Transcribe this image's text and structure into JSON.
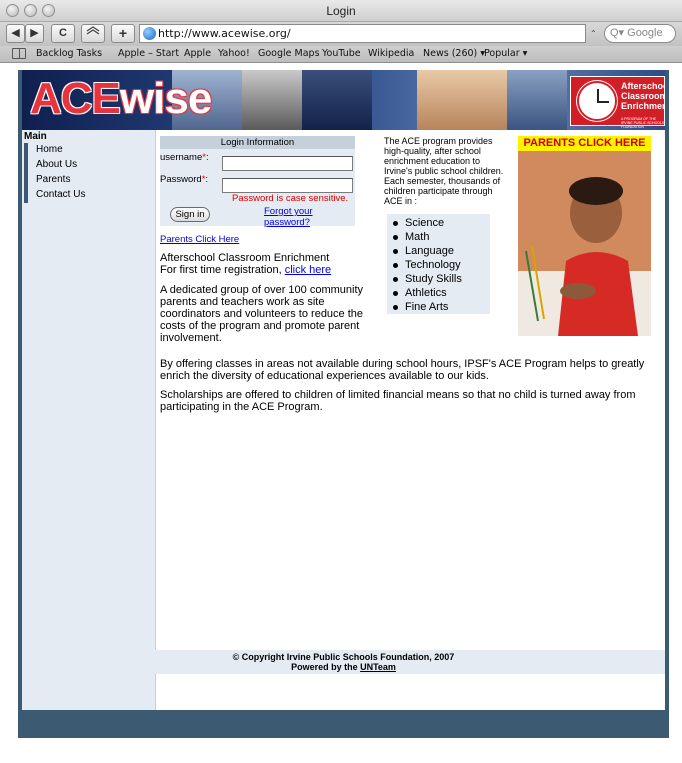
{
  "window": {
    "title": "Login"
  },
  "toolbar": {
    "back": "◀",
    "forward": "▶",
    "reload": "C",
    "add": "+",
    "url": "http://www.acewise.org/",
    "search_placeholder": "Q▾ Google"
  },
  "bookmarks": [
    "Backlog Tasks",
    "Apple – Start",
    "Apple",
    "Yahoo!",
    "Google Maps",
    "YouTube",
    "Wikipedia",
    "News (260) ▾",
    "Popular ▾"
  ],
  "banner": {
    "logo_ace": "ACE",
    "logo_wise": "wise",
    "badge_lines": [
      "Afterschool",
      "Classroom",
      "Enrichment"
    ],
    "badge_small": "A PROGRAM OF THE IRVINE PUBLIC SCHOOLS FOUNDATION"
  },
  "sidebar": {
    "heading": "Main",
    "items": [
      "Home",
      "About Us",
      "Parents",
      "Contact Us"
    ]
  },
  "login": {
    "heading": "Login Information",
    "username_label": "username",
    "password_label": "Password",
    "required_mark": "*",
    "colon": ":",
    "case_note": "Password is case sensitive.",
    "forgot": "Forgot your password?",
    "signin": "Sign in"
  },
  "main": {
    "parents_link": "Parents Click Here",
    "ace_title": "Afterschool Classroom Enrichment",
    "registration_prefix": "For first time registration, ",
    "registration_link": "click here",
    "paragraph1": "A dedicated group of over 100 community parents and teachers work as site coordinators and volunteers to reduce the costs of the program and promote parent involvement.",
    "paragraph2": "By offering classes in areas not available during school hours, IPSF's ACE Program helps to greatly enrich the diversity of educational experiences available to our kids.",
    "paragraph3": "Scholarships are offered to children of limited financial means so that no child is turned away from participating in the ACE Program."
  },
  "intro": {
    "text": "The ACE program provides high-quality, after school enrichment education to Irvine's public school children. Each semester, thousands of children participate through ACE in :",
    "subjects": [
      "Science",
      "Math",
      "Language",
      "Technology",
      "Study Skills",
      "Athletics",
      "Fine Arts"
    ]
  },
  "ad": {
    "heading": "PARENTS CLICK HERE"
  },
  "footer": {
    "copyright": "© Copyright Irvine Public Schools Foundation, 2007",
    "powered_prefix": "Powered by the ",
    "powered_link": "UNTeam"
  }
}
